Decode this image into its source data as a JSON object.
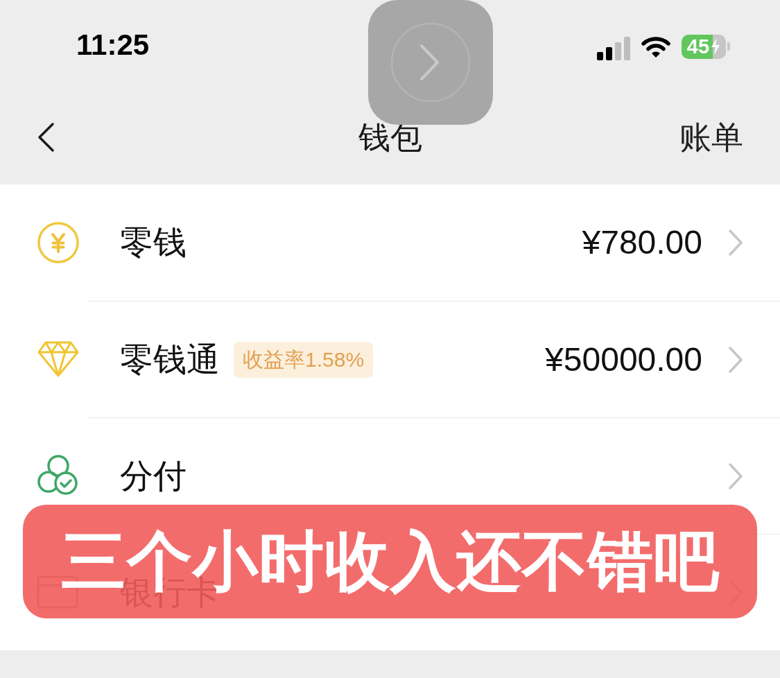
{
  "status_bar": {
    "time": "11:25",
    "battery": "45",
    "charging": true
  },
  "nav_bar": {
    "title": "钱包",
    "action": "账单"
  },
  "items": [
    {
      "label": "零钱",
      "amount": "¥780.00"
    },
    {
      "label": "零钱通",
      "badge": "收益率1.58%",
      "amount": "¥50000.00"
    },
    {
      "label": "分付"
    },
    {
      "label": "银行卡"
    }
  ],
  "caption": {
    "text": "三个小时收入还不错吧"
  }
}
